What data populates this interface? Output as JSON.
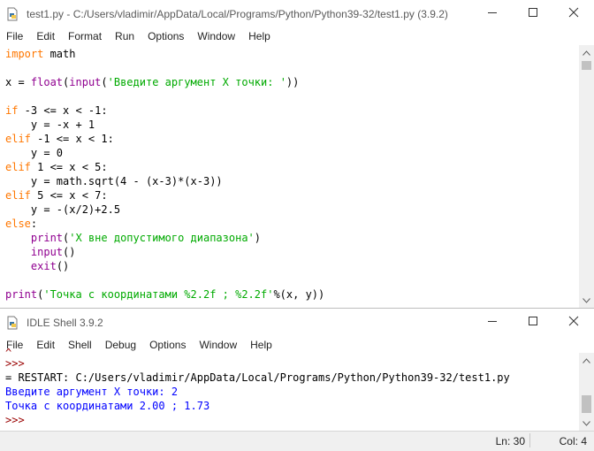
{
  "editor": {
    "title": "test1.py - C:/Users/vladimir/AppData/Local/Programs/Python/Python39-32/test1.py (3.9.2)",
    "menu": [
      "File",
      "Edit",
      "Format",
      "Run",
      "Options",
      "Window",
      "Help"
    ],
    "code": [
      [
        {
          "t": "import",
          "c": "kw"
        },
        {
          "t": " math",
          "c": ""
        }
      ],
      [],
      [
        {
          "t": "x = ",
          "c": ""
        },
        {
          "t": "float",
          "c": "bi"
        },
        {
          "t": "(",
          "c": ""
        },
        {
          "t": "input",
          "c": "bi"
        },
        {
          "t": "(",
          "c": ""
        },
        {
          "t": "'Введите аргумент X точки: '",
          "c": "str"
        },
        {
          "t": "))",
          "c": ""
        }
      ],
      [],
      [
        {
          "t": "if",
          "c": "kw"
        },
        {
          "t": " -3 <= x < -1:",
          "c": ""
        }
      ],
      [
        {
          "t": "    y = -x + 1",
          "c": ""
        }
      ],
      [
        {
          "t": "elif",
          "c": "kw"
        },
        {
          "t": " -1 <= x < 1:",
          "c": ""
        }
      ],
      [
        {
          "t": "    y = 0",
          "c": ""
        }
      ],
      [
        {
          "t": "elif",
          "c": "kw"
        },
        {
          "t": " 1 <= x < 5:",
          "c": ""
        }
      ],
      [
        {
          "t": "    y = math.sqrt(4 - (x-3)*(x-3))",
          "c": ""
        }
      ],
      [
        {
          "t": "elif",
          "c": "kw"
        },
        {
          "t": " 5 <= x < 7:",
          "c": ""
        }
      ],
      [
        {
          "t": "    y = -(x/2)+2.5",
          "c": ""
        }
      ],
      [
        {
          "t": "else",
          "c": "kw"
        },
        {
          "t": ":",
          "c": ""
        }
      ],
      [
        {
          "t": "    ",
          "c": ""
        },
        {
          "t": "print",
          "c": "bi"
        },
        {
          "t": "(",
          "c": ""
        },
        {
          "t": "'X вне допустимого диапазона'",
          "c": "str"
        },
        {
          "t": ")",
          "c": ""
        }
      ],
      [
        {
          "t": "    ",
          "c": ""
        },
        {
          "t": "input",
          "c": "bi"
        },
        {
          "t": "()",
          "c": ""
        }
      ],
      [
        {
          "t": "    ",
          "c": ""
        },
        {
          "t": "exit",
          "c": "bi"
        },
        {
          "t": "()",
          "c": ""
        }
      ],
      [],
      [
        {
          "t": "print",
          "c": "bi"
        },
        {
          "t": "(",
          "c": ""
        },
        {
          "t": "'Точка с координатами %2.2f ; %2.2f'",
          "c": "str"
        },
        {
          "t": "%(x, y))",
          "c": ""
        }
      ]
    ]
  },
  "shell": {
    "title": "IDLE Shell 3.9.2",
    "menu": [
      "File",
      "Edit",
      "Shell",
      "Debug",
      "Options",
      "Window",
      "Help"
    ],
    "output": [
      {
        "t": ">>>",
        "c": "prompt"
      },
      {
        "t": "= RESTART: C:/Users/vladimir/AppData/Local/Programs/Python/Python39-32/test1.py",
        "c": ""
      },
      {
        "t": "Введите аргумент X точки: 2",
        "c": "stdout"
      },
      {
        "t": "Точка с координатами 2.00 ; 1.73",
        "c": "stdout"
      },
      {
        "t": ">>>",
        "c": "prompt"
      }
    ],
    "status": {
      "ln": "Ln: 30",
      "col": "Col: 4"
    }
  },
  "icons": {
    "app": "python-file-icon",
    "minimize": "minimize-icon",
    "maximize": "maximize-icon",
    "close": "close-icon",
    "scroll_up": "chevron-up-icon",
    "scroll_down": "chevron-down-icon"
  }
}
